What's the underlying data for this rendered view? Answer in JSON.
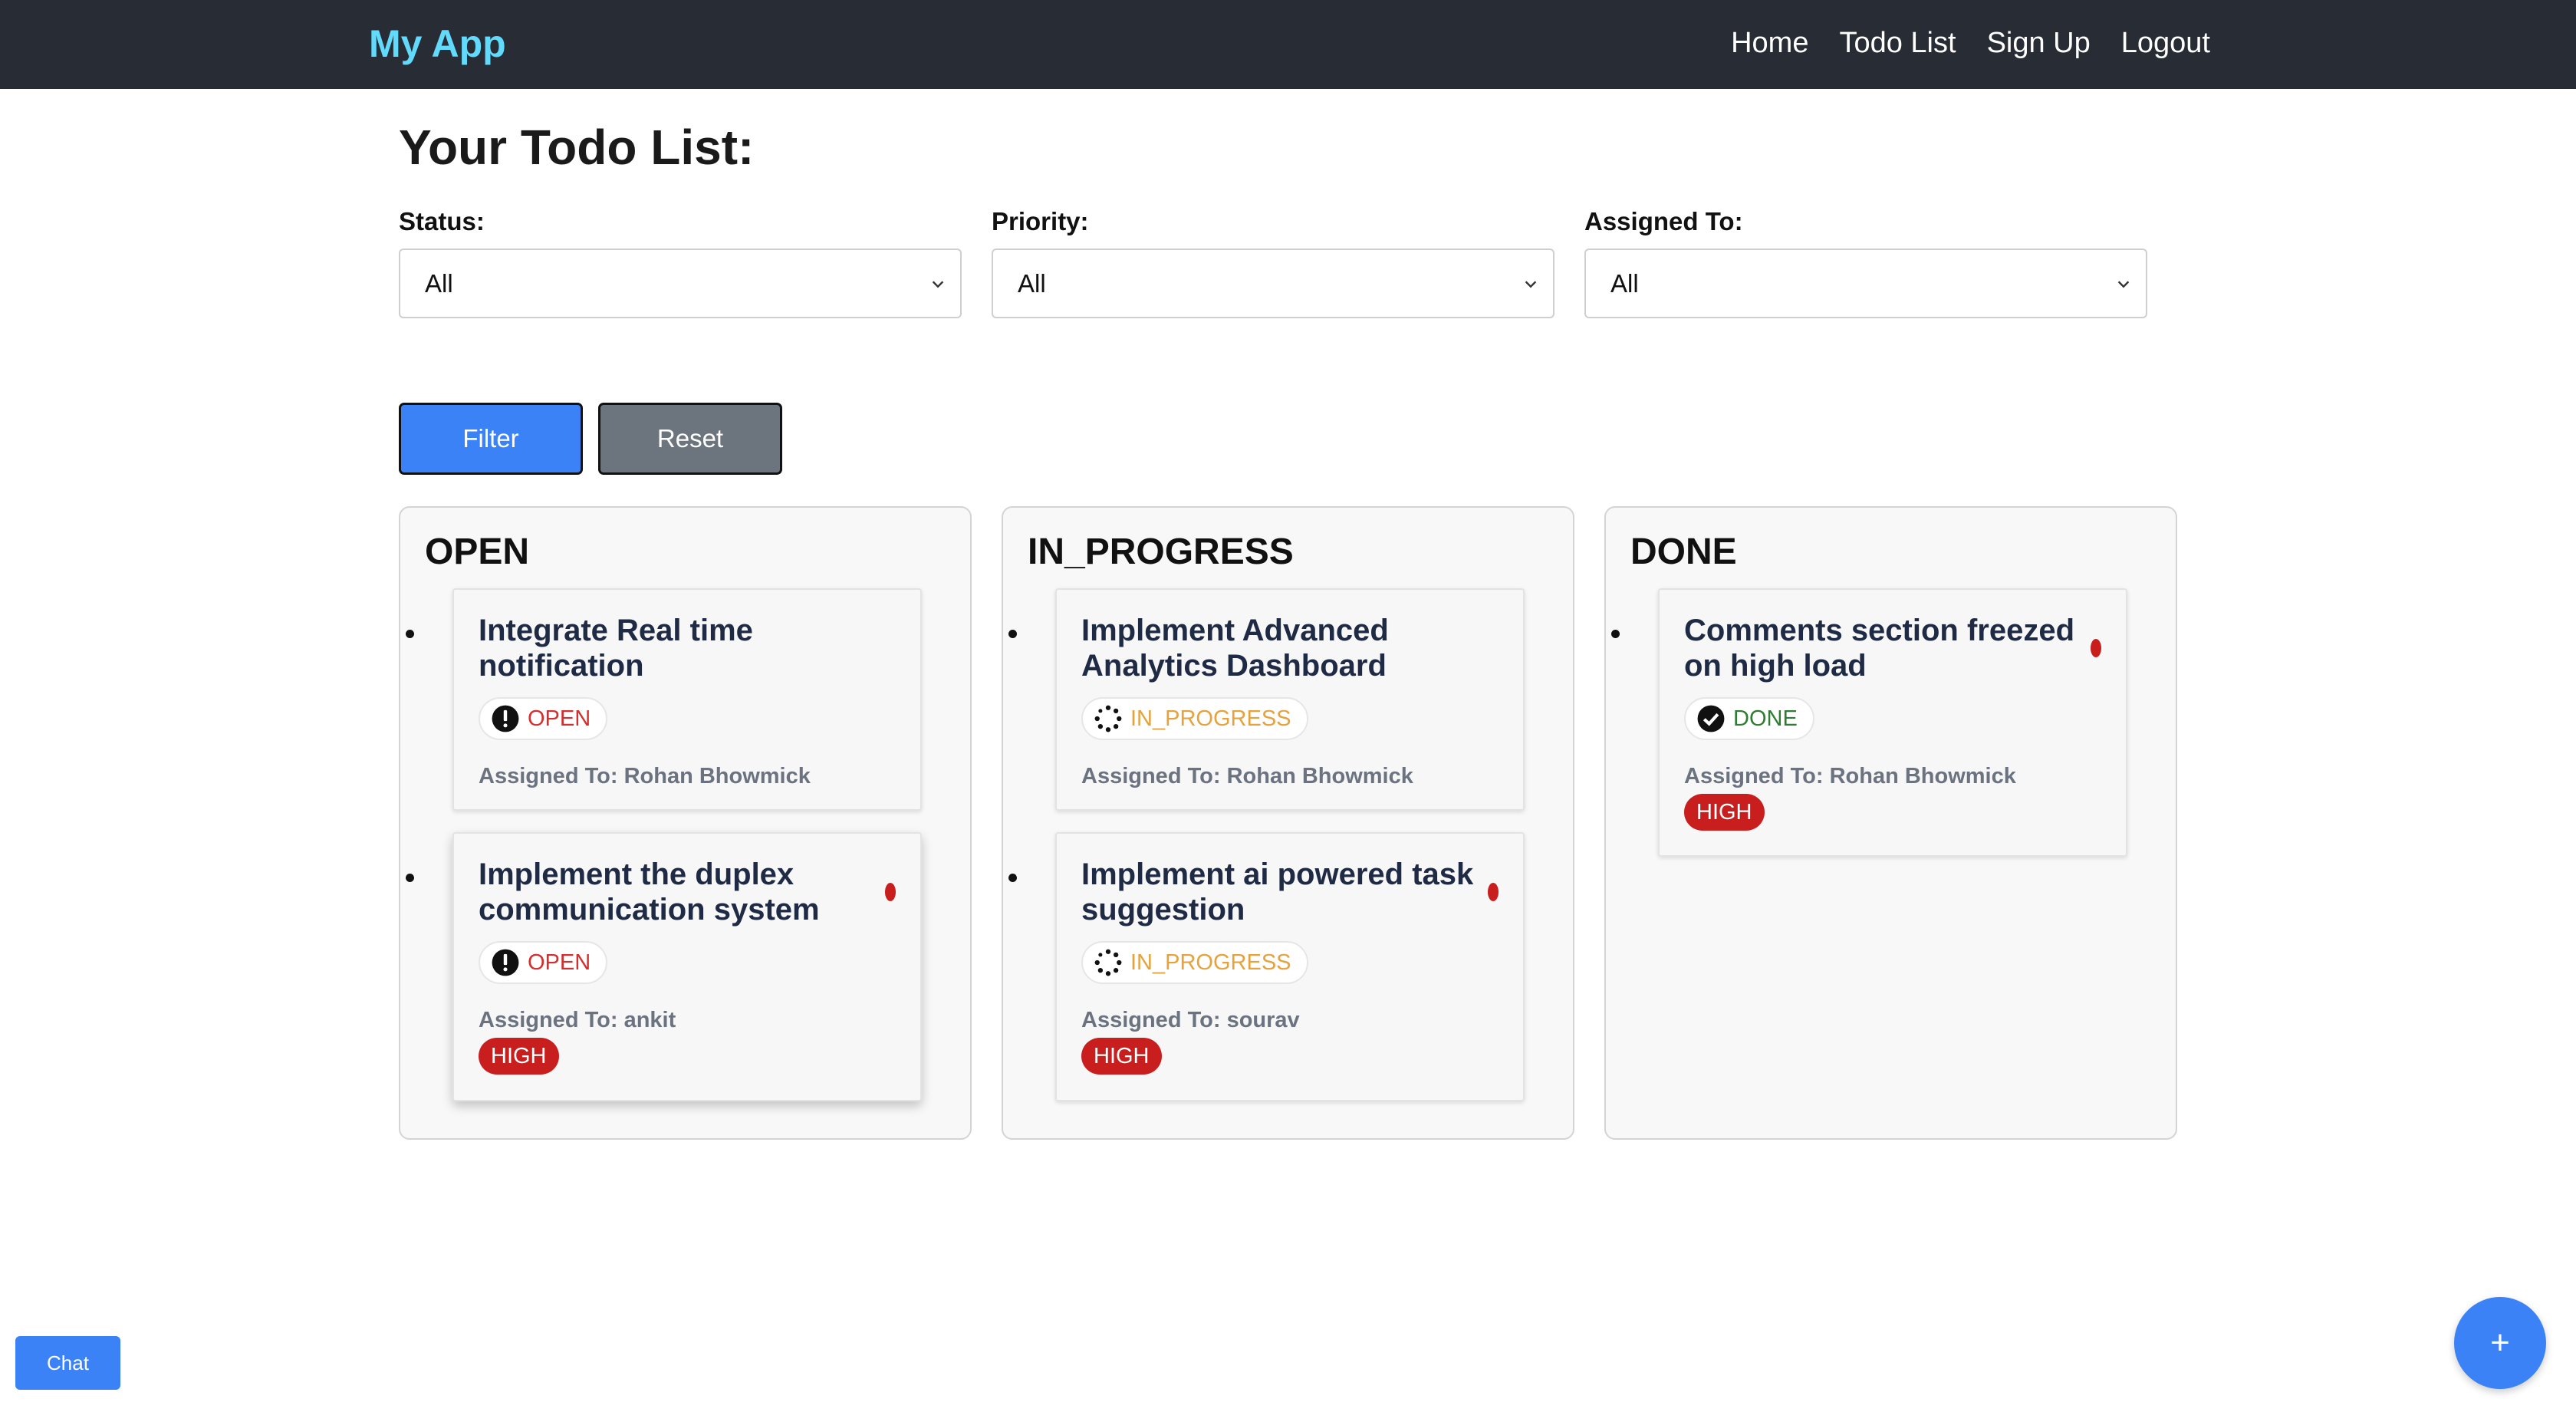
{
  "navbar": {
    "brand": "My App",
    "links": [
      "Home",
      "Todo List",
      "Sign Up",
      "Logout"
    ]
  },
  "page_title": "Your Todo List:",
  "filters": {
    "status": {
      "label": "Status:",
      "value": "All"
    },
    "priority": {
      "label": "Priority:",
      "value": "All"
    },
    "assigned_to": {
      "label": "Assigned To:",
      "value": "All"
    }
  },
  "buttons": {
    "filter": "Filter",
    "reset": "Reset"
  },
  "columns": [
    {
      "title": "OPEN",
      "cards": [
        {
          "title": "Integrate Real time notification",
          "status": "OPEN",
          "assigned": "Assigned To: Rohan Bhowmick",
          "priority": ""
        },
        {
          "title": "Implement the duplex communication system",
          "status": "OPEN",
          "assigned": "Assigned To: ankit",
          "priority": "HIGH"
        }
      ]
    },
    {
      "title": "IN_PROGRESS",
      "cards": [
        {
          "title": "Implement Advanced Analytics Dashboard",
          "status": "IN_PROGRESS",
          "assigned": "Assigned To: Rohan Bhowmick",
          "priority": ""
        },
        {
          "title": "Implement ai powered task suggestion",
          "status": "IN_PROGRESS",
          "assigned": "Assigned To: sourav",
          "priority": "HIGH"
        }
      ]
    },
    {
      "title": "DONE",
      "cards": [
        {
          "title": "Comments section freezed on high load",
          "status": "DONE",
          "assigned": "Assigned To: Rohan Bhowmick",
          "priority": "HIGH"
        }
      ]
    }
  ],
  "chat_button": "Chat",
  "fab_label": "+",
  "colors": {
    "navbar_bg": "#282c34",
    "brand": "#61dafb",
    "primary": "#3b82f6",
    "secondary": "#6c757d",
    "high_priority": "#c81e1e",
    "open_status": "#d32f2f",
    "in_progress_status": "#e6a23c",
    "done_status": "#2e7d32"
  },
  "icons": {
    "open": "exclamation-circle-icon",
    "in_progress": "spinner-icon",
    "done": "check-circle-icon"
  }
}
